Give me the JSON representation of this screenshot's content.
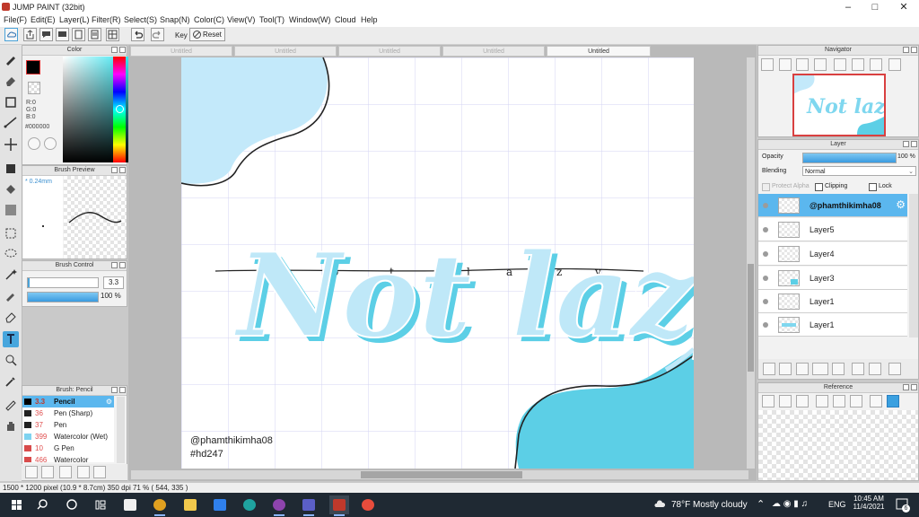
{
  "window": {
    "title": "JUMP PAINT (32bit)",
    "controls": [
      "minimize",
      "maximize",
      "close"
    ]
  },
  "menu": [
    "File(F)",
    "Edit(E)",
    "Layer(L)",
    "Filter(R)",
    "Select(S)",
    "Snap(N)",
    "Color(C)",
    "View(V)",
    "Tool(T)",
    "Window(W)",
    "Cloud",
    "Help"
  ],
  "toolbar": {
    "key_label": "Key",
    "reset_label": "Reset"
  },
  "color_panel": {
    "title": "Color",
    "r": "R:0",
    "g": "G:0",
    "b": "B:0",
    "hex": "#000000",
    "current_color": "#000000"
  },
  "brush_preview": {
    "title": "Brush Preview",
    "size": "* 0.24mm"
  },
  "brush_control": {
    "title": "Brush Control",
    "size_value": "3.3",
    "opacity_value": "100 %"
  },
  "brush_list": {
    "title": "Brush: Pencil",
    "items": [
      {
        "size": "3.3",
        "name": "Pencil",
        "color": "#000000"
      },
      {
        "size": "36",
        "name": "Pen (Sharp)",
        "color": "#222222"
      },
      {
        "size": "37",
        "name": "Pen",
        "color": "#222222"
      },
      {
        "size": "399",
        "name": "Watercolor (Wet)",
        "color": "#7fd3f0"
      },
      {
        "size": "10",
        "name": "G Pen",
        "color": "#d84b4b"
      },
      {
        "size": "466",
        "name": "Watercolor",
        "color": "#d84b4b"
      }
    ]
  },
  "doc_tabs": [
    "Untitled",
    "Untitled",
    "Untitled",
    "Untitled",
    "Untitled"
  ],
  "canvas": {
    "title_text": "Not lazy",
    "watermark_handle": "@phamthikimha08",
    "watermark_tag": "#hd247",
    "accent_color": "#5ccfe6",
    "light_color": "#bfe8f8"
  },
  "navigator": {
    "title": "Navigator"
  },
  "layer_panel": {
    "title": "Layer",
    "opacity_label": "Opacity",
    "opacity_value": "100 %",
    "blending_label": "Blending",
    "blending_value": "Normal",
    "protect_alpha_label": "Protect Alpha",
    "clipping_label": "Clipping",
    "lock_label": "Lock",
    "layers": [
      "@phamthikimha08",
      "Layer5",
      "Layer4",
      "Layer3",
      "Layer1",
      "Layer1"
    ]
  },
  "reference": {
    "title": "Reference"
  },
  "status": "1500 * 1200 pixel   (10.9 * 8.7cm)  350 dpi  71 %  ( 544, 335 )",
  "taskbar": {
    "weather": "78°F  Mostly cloudy",
    "language": "ENG",
    "time": "10:45 AM",
    "date": "11/4/2021",
    "notifications": "6"
  }
}
